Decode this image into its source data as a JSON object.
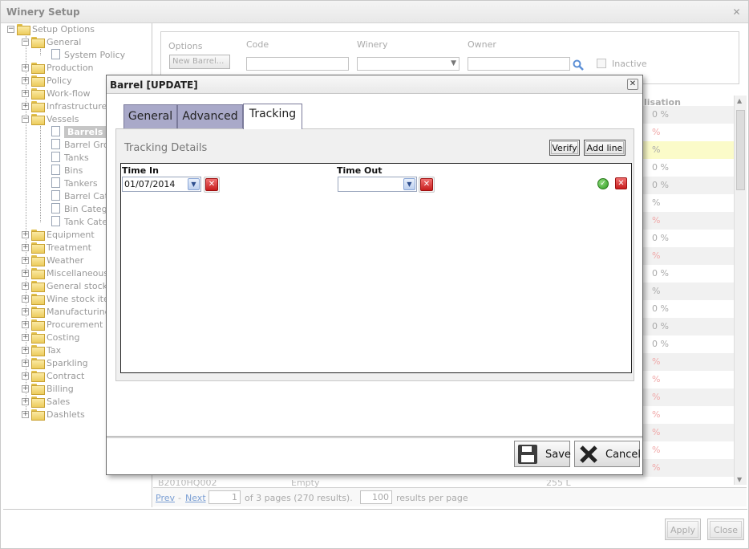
{
  "window": {
    "title": "Winery Setup"
  },
  "tree": {
    "root": "Setup Options",
    "items": [
      {
        "label": "General",
        "kind": "folder",
        "level": 1,
        "expanded": true
      },
      {
        "label": "System Policy",
        "kind": "doc",
        "level": 2
      },
      {
        "label": "Production",
        "kind": "folder",
        "level": 1
      },
      {
        "label": "Policy",
        "kind": "folder",
        "level": 1
      },
      {
        "label": "Work-flow",
        "kind": "folder",
        "level": 1
      },
      {
        "label": "Infrastructure",
        "kind": "folder",
        "level": 1
      },
      {
        "label": "Vessels",
        "kind": "folder",
        "level": 1,
        "expanded": true
      },
      {
        "label": "Barrels",
        "kind": "doc",
        "level": 2,
        "selected": true
      },
      {
        "label": "Barrel Grou",
        "kind": "doc",
        "level": 2
      },
      {
        "label": "Tanks",
        "kind": "doc",
        "level": 2
      },
      {
        "label": "Bins",
        "kind": "doc",
        "level": 2
      },
      {
        "label": "Tankers",
        "kind": "doc",
        "level": 2
      },
      {
        "label": "Barrel Cate",
        "kind": "doc",
        "level": 2
      },
      {
        "label": "Bin Catego",
        "kind": "doc",
        "level": 2
      },
      {
        "label": "Tank Categ",
        "kind": "doc",
        "level": 2
      },
      {
        "label": "Equipment",
        "kind": "folder",
        "level": 1
      },
      {
        "label": "Treatment",
        "kind": "folder",
        "level": 1
      },
      {
        "label": "Weather",
        "kind": "folder",
        "level": 1
      },
      {
        "label": "Miscellaneous",
        "kind": "folder",
        "level": 1
      },
      {
        "label": "General stock i",
        "kind": "folder",
        "level": 1
      },
      {
        "label": "Wine stock item",
        "kind": "folder",
        "level": 1
      },
      {
        "label": "Manufacturing",
        "kind": "folder",
        "level": 1
      },
      {
        "label": "Procurement",
        "kind": "folder",
        "level": 1
      },
      {
        "label": "Costing",
        "kind": "folder",
        "level": 1
      },
      {
        "label": "Tax",
        "kind": "folder",
        "level": 1
      },
      {
        "label": "Sparkling",
        "kind": "folder",
        "level": 1
      },
      {
        "label": "Contract",
        "kind": "folder",
        "level": 1
      },
      {
        "label": "Billing",
        "kind": "folder",
        "level": 1
      },
      {
        "label": "Sales",
        "kind": "folder",
        "level": 1
      },
      {
        "label": "Dashlets",
        "kind": "folder",
        "level": 1
      }
    ]
  },
  "filter": {
    "options_label": "Options",
    "new_barrel_label": "New Barrel...",
    "code_label": "Code",
    "code_value": "",
    "winery_label": "Winery",
    "winery_value": "",
    "owner_label": "Owner",
    "owner_value": "",
    "inactive_label": "Inactive"
  },
  "grid": {
    "header": "lisation",
    "rows": [
      {
        "text": "0 %",
        "style": "alt"
      },
      {
        "text": "%",
        "style": "red"
      },
      {
        "text": "%",
        "style": "hl"
      },
      {
        "text": "0 %",
        "style": ""
      },
      {
        "text": "0 %",
        "style": "alt"
      },
      {
        "text": "%",
        "style": ""
      },
      {
        "text": "%",
        "style": "alt red"
      },
      {
        "text": "0 %",
        "style": ""
      },
      {
        "text": "%",
        "style": "alt red"
      },
      {
        "text": "0 %",
        "style": ""
      },
      {
        "text": "%",
        "style": "alt"
      },
      {
        "text": "0 %",
        "style": ""
      },
      {
        "text": "0 %",
        "style": "alt"
      },
      {
        "text": "0 %",
        "style": ""
      },
      {
        "text": "%",
        "style": "alt red"
      },
      {
        "text": "%",
        "style": "red"
      },
      {
        "text": "%",
        "style": "alt red"
      },
      {
        "text": "%",
        "style": "red"
      },
      {
        "text": "%",
        "style": "alt red"
      },
      {
        "text": "%",
        "style": "red"
      },
      {
        "text": "%",
        "style": "alt red"
      }
    ],
    "last_row": {
      "code": "B2010HQ002",
      "status": "Empty",
      "size": "255 L",
      "pct": "0 %"
    }
  },
  "pager": {
    "prev": "Prev",
    "sep": "-",
    "next": "Next",
    "page": "1",
    "summary": "of 3 pages (270 results).",
    "per_page": "100",
    "per_page_label": "results per page"
  },
  "buttons": {
    "apply": "Apply",
    "close": "Close"
  },
  "modal": {
    "title": "Barrel [UPDATE]",
    "tabs": [
      "General",
      "Advanced",
      "Tracking"
    ],
    "active_tab": "Tracking",
    "panel_title": "Tracking Details",
    "verify_label": "Verify",
    "add_line_label": "Add line",
    "columns": {
      "time_in": "Time In",
      "time_out": "Time Out"
    },
    "row": {
      "time_in": "01/07/2014",
      "time_out": ""
    },
    "save_label": "Save",
    "cancel_label": "Cancel"
  },
  "colors": {
    "tab_inactive": "#a9a9c9",
    "link": "#7b9fd4",
    "selected_tree": "#c6c6c6",
    "highlight_row": "#fbfbc9"
  }
}
